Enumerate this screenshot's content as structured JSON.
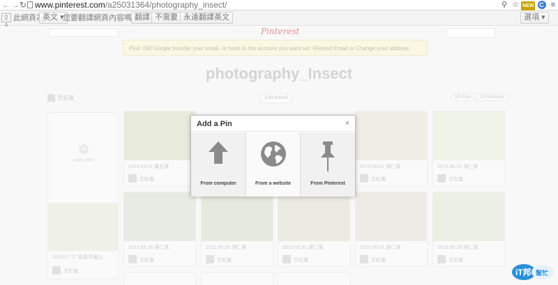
{
  "browser": {
    "url_host": "www.pinterest.com",
    "url_path": "/a25031364/photography_insect/",
    "new_badge": "NEW",
    "ext_letter": "C"
  },
  "translate_bar": {
    "prefix": "此網頁為",
    "language": "英文",
    "question": "您要翻譯網頁內容嗎？",
    "translate_btn": "翻譯",
    "no_btn": "不需要",
    "always_btn": "永遠翻譯英文",
    "options_btn": "選項"
  },
  "page": {
    "logo": "Pinterest",
    "notice": "Psst. Did Google transfer your email, or hook to the account you want set. Resend Email or Change your address",
    "board_title": "photography_Insect",
    "owner": "文虹嵐",
    "edit_board": "Edit Board",
    "pins": "54 Pins",
    "followers": "2 Followers",
    "add_pin": "Add a Pin",
    "card_captions": [
      "2013.06.01 臺北濱",
      "2013.06.01 濱仁濱",
      "2013.06.31 濱仁濱",
      "2013.06.26 濱仁濱",
      "2013.06.31 濱仁濱",
      "2013.06.31 濱仁濱",
      "2013.06.01 濱仁濱",
      "2013.06.31 濱仁濱",
      "2013.06.26 濱仁濱",
      "2013.07.27 嘉義中埔山"
    ],
    "card_user": "文虹嵐"
  },
  "modal": {
    "title": "Add a Pin",
    "close": "×",
    "options": [
      {
        "label": "From computer",
        "icon": "upload-arrow-icon"
      },
      {
        "label": "From a website",
        "icon": "globe-icon"
      },
      {
        "label": "From Pinterest",
        "icon": "pushpin-icon"
      }
    ]
  },
  "watermark": {
    "brand": "iT邦",
    "sub": "幫忙"
  }
}
